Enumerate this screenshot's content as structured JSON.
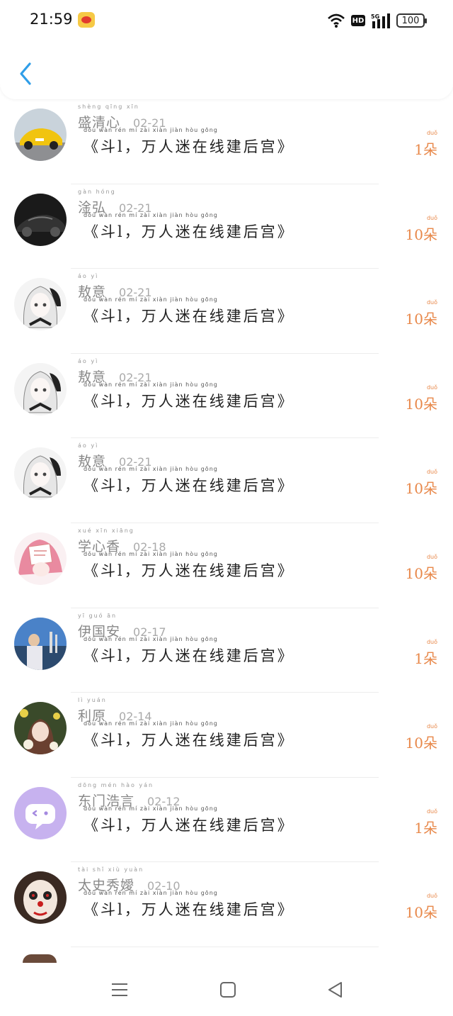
{
  "status_bar": {
    "time": "21:59",
    "battery": "100",
    "network": "5G",
    "hd": "HD"
  },
  "header": {
    "back_icon": "chevron-left-icon",
    "accent_color": "#2f9ee8"
  },
  "list": {
    "title_pinyin": "dǒu   wàn rén mí zài xiàn jiàn hòu gōng",
    "count_pinyin": "duǒ",
    "items": [
      {
        "name": "盛清心",
        "name_pinyin": "shèng qīng xīn",
        "date": "02-21",
        "title": "《斗l，万人迷在线建后宫》",
        "count": "1朵",
        "avatar": "yellow-sports-car"
      },
      {
        "name": "淦弘",
        "name_pinyin": "gàn hóng",
        "date": "02-21",
        "title": "《斗l，万人迷在线建后宫》",
        "count": "10朵",
        "avatar": "black-sports-car"
      },
      {
        "name": "敖意",
        "name_pinyin": "áo yì",
        "date": "02-21",
        "title": "《斗l，万人迷在线建后宫》",
        "count": "10朵",
        "avatar": "anime-white-hair"
      },
      {
        "name": "敖意",
        "name_pinyin": "áo yì",
        "date": "02-21",
        "title": "《斗l，万人迷在线建后宫》",
        "count": "10朵",
        "avatar": "anime-white-hair"
      },
      {
        "name": "敖意",
        "name_pinyin": "áo yì",
        "date": "02-21",
        "title": "《斗l，万人迷在线建后宫》",
        "count": "10朵",
        "avatar": "anime-white-hair"
      },
      {
        "name": "学心香",
        "name_pinyin": "xué xīn xiāng",
        "date": "02-18",
        "title": "《斗l，万人迷在线建后宫》",
        "count": "10朵",
        "avatar": "anime-pink-hair"
      },
      {
        "name": "伊国安",
        "name_pinyin": "yī guó ān",
        "date": "02-17",
        "title": "《斗l，万人迷在线建后宫》",
        "count": "1朵",
        "avatar": "harbor-person"
      },
      {
        "name": "利原",
        "name_pinyin": "lì yuán",
        "date": "02-14",
        "title": "《斗l，万人迷在线建后宫》",
        "count": "10朵",
        "avatar": "girl-flowers"
      },
      {
        "name": "东门浩言",
        "name_pinyin": "dōng mén hào yán",
        "date": "02-12",
        "title": "《斗l，万人迷在线建后宫》",
        "count": "1朵",
        "avatar": "purple-chat-bubble"
      },
      {
        "name": "太史秀嬡",
        "name_pinyin": "tài shǐ xiù yuàn",
        "date": "02-10",
        "title": "《斗l，万人迷在线建后宫》",
        "count": "10朵",
        "avatar": "clown-face"
      }
    ]
  },
  "navbar": {
    "menu_icon": "menu-icon",
    "home_icon": "home-square-icon",
    "back_icon": "back-triangle-icon"
  }
}
